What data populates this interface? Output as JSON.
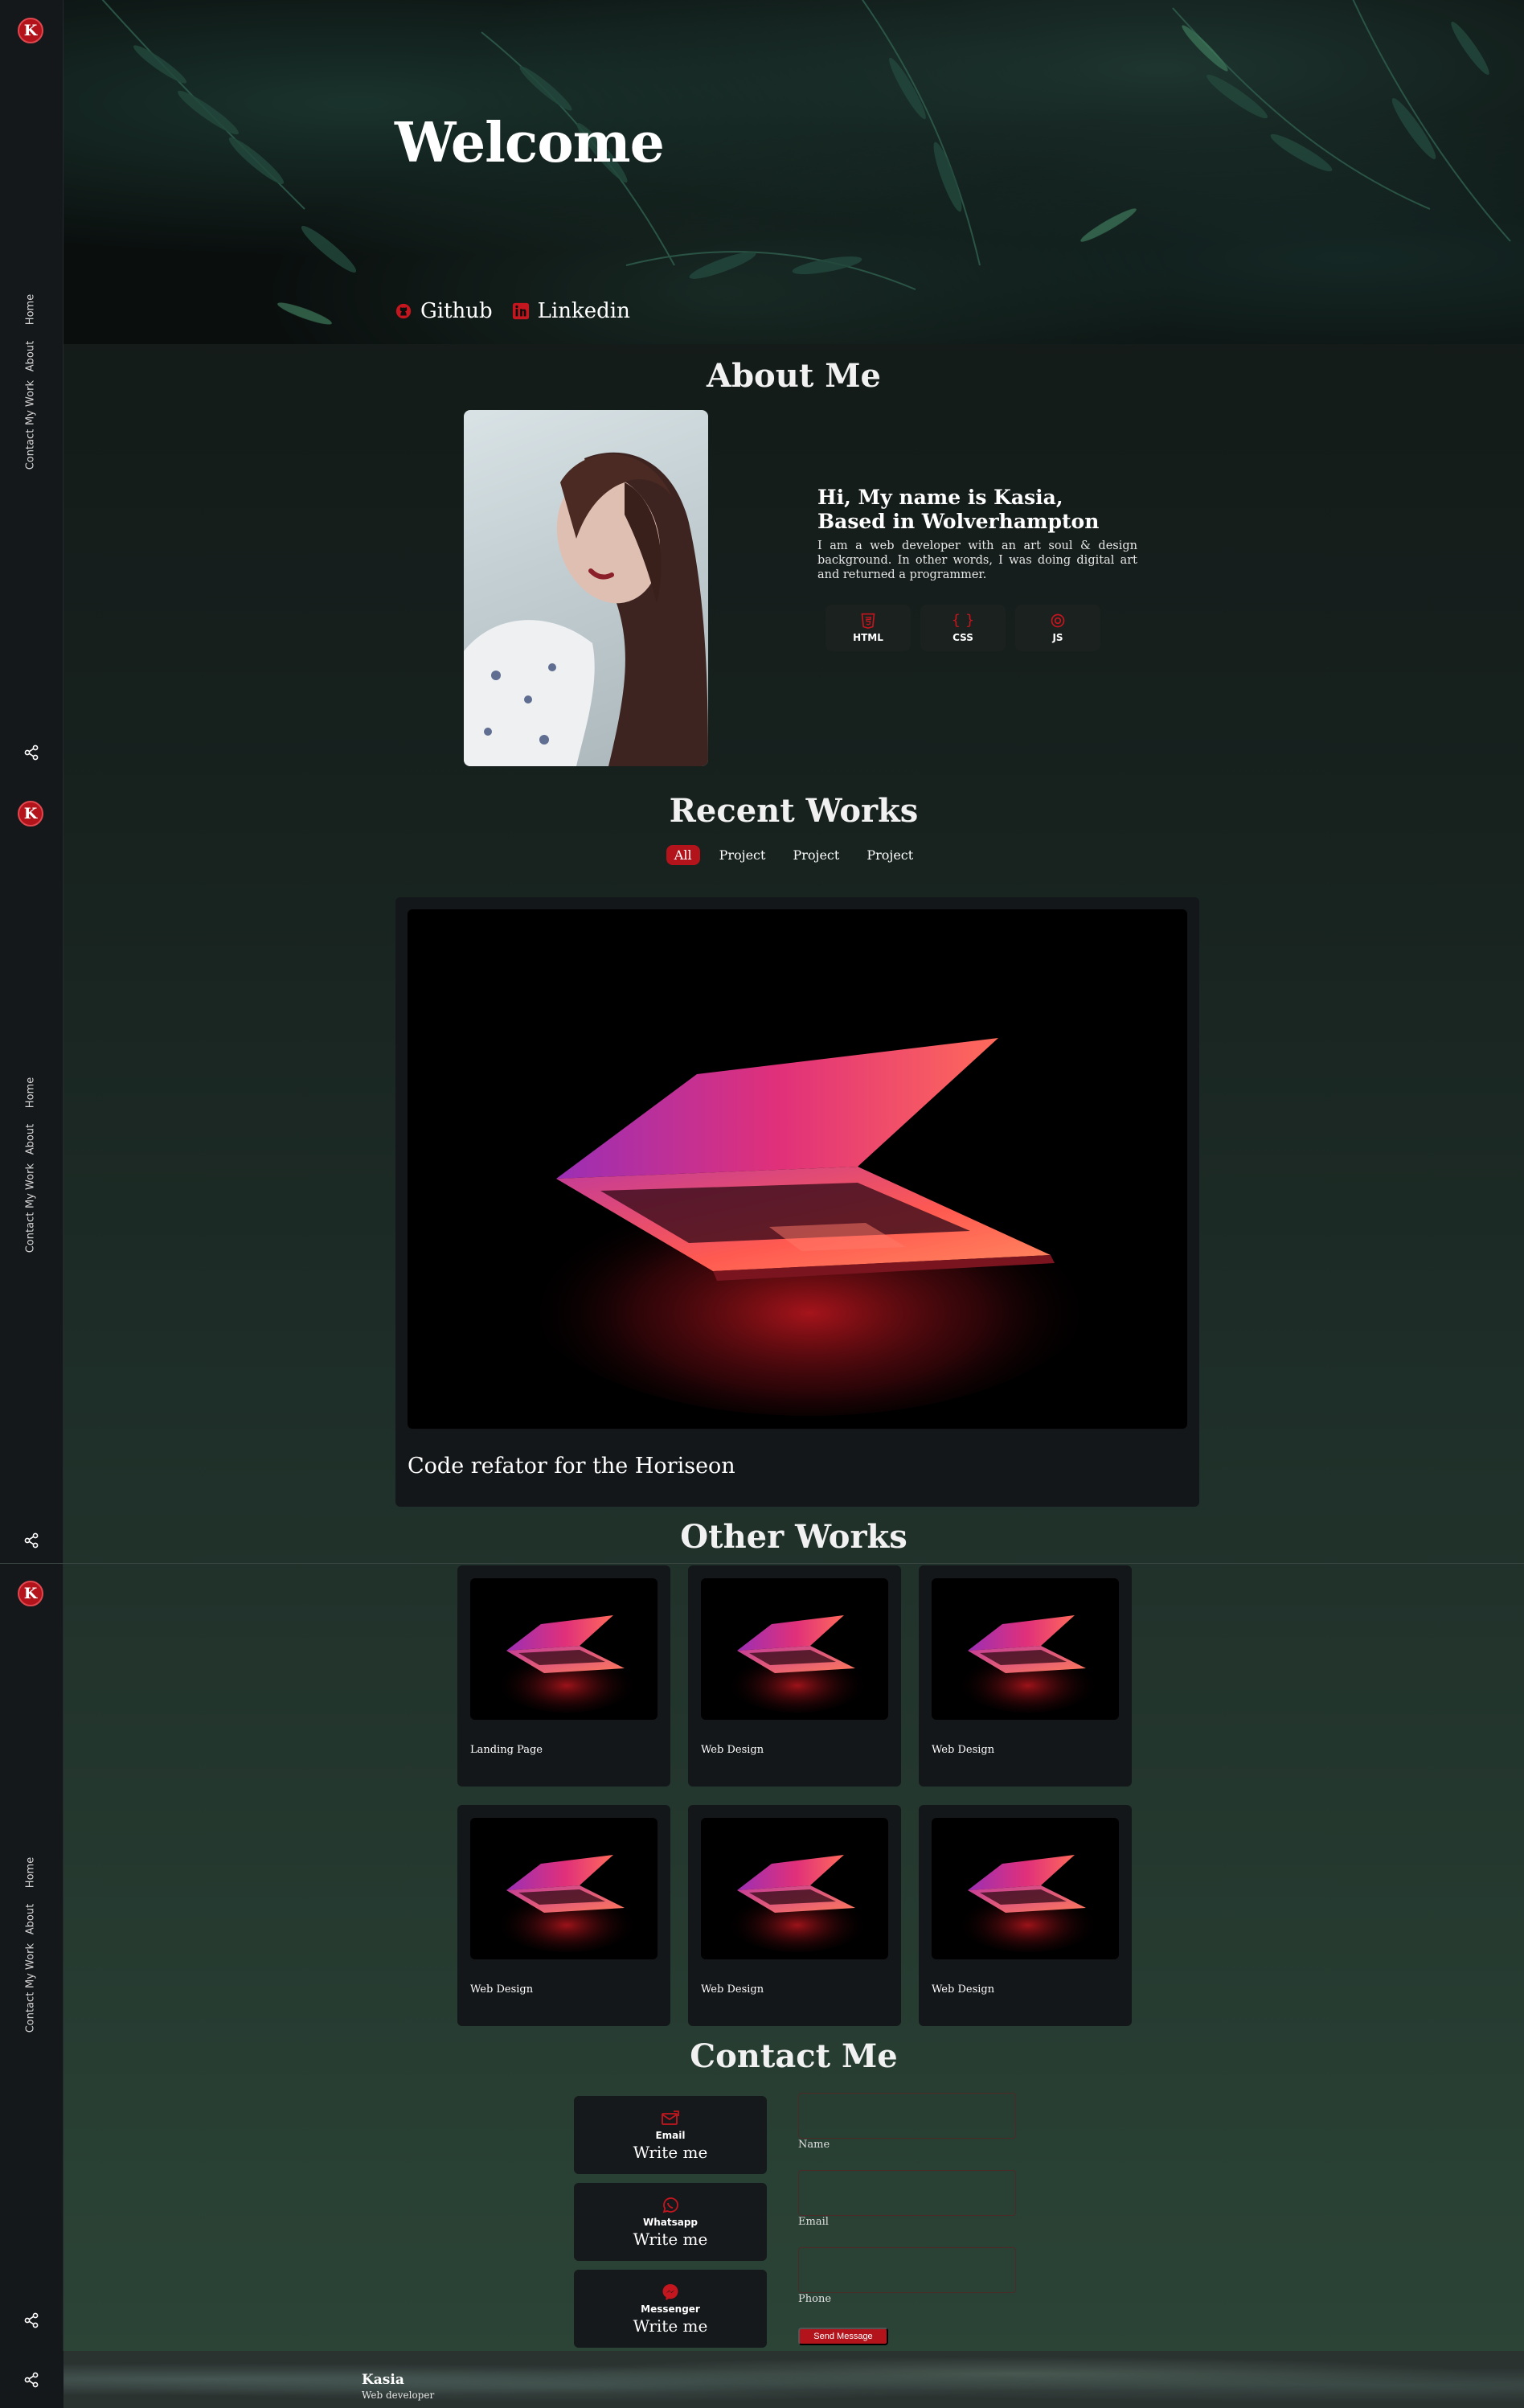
{
  "brand": {
    "logo_letter": "K"
  },
  "nav": {
    "items": [
      "Home",
      "About",
      "My Work",
      "Contact"
    ]
  },
  "hero": {
    "title": "Welcome",
    "links": [
      {
        "label": "Github",
        "icon": "github-icon"
      },
      {
        "label": "Linkedin",
        "icon": "linkedin-icon"
      }
    ]
  },
  "about": {
    "title": "About Me",
    "heading": "Hi, My name is Kasia, Based in Wolverhampton",
    "description": "I am a web developer with an art soul & design background. In other words, I was doing digital art and returned a programmer.",
    "skills": [
      {
        "name": "HTML",
        "icon": "html5-icon"
      },
      {
        "name": "CSS",
        "icon": "braces-icon"
      },
      {
        "name": "JS",
        "icon": "js-icon"
      }
    ]
  },
  "recent": {
    "title": "Recent Works",
    "filters": [
      "All",
      "Project",
      "Project",
      "Project"
    ],
    "active_filter": "All",
    "feature": {
      "caption": "Code refator for the Horiseon"
    }
  },
  "other": {
    "title": "Other Works",
    "items": [
      "Landing Page",
      "Web Design",
      "Web Design",
      "Web Design",
      "Web Design",
      "Web Design"
    ]
  },
  "contact": {
    "title": "Contact Me",
    "cards": [
      {
        "title": "Email",
        "link": "Write me",
        "icon": "email-icon"
      },
      {
        "title": "Whatsapp",
        "link": "Write me",
        "icon": "whatsapp-icon"
      },
      {
        "title": "Messenger",
        "link": "Write me",
        "icon": "messenger-icon"
      }
    ],
    "fields": [
      "Name",
      "Email",
      "Phone"
    ],
    "send_label": "Send Message"
  },
  "footer": {
    "name": "Kasia",
    "role": "Web developer"
  },
  "colors": {
    "accent": "#b3141c",
    "sidebar": "#15181b",
    "card": "#141719"
  }
}
